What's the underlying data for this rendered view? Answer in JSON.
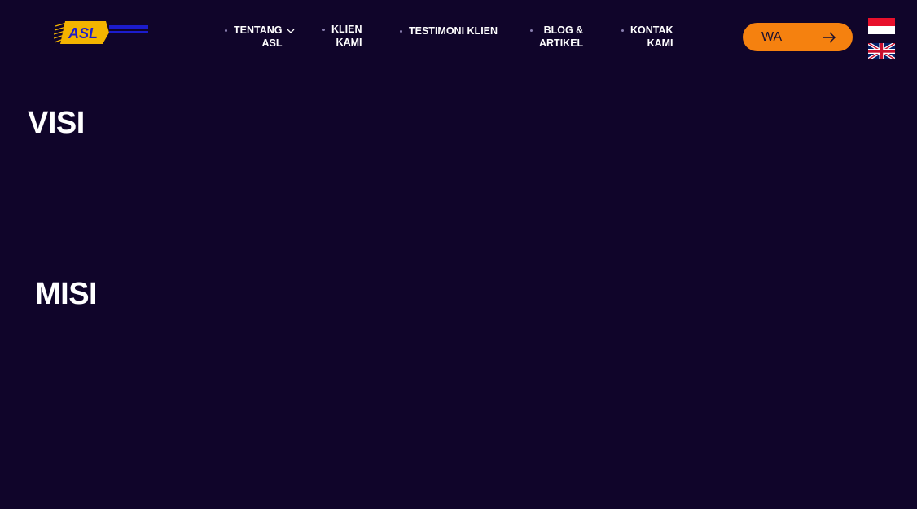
{
  "header": {
    "logo_text": "ASL",
    "nav": [
      {
        "label_line1": "TENTANG",
        "label_line2": "ASL",
        "has_dropdown": true
      },
      {
        "label_line1": "KLIEN",
        "label_line2": "KAMI"
      },
      {
        "label_line1": "TESTIMONI KLIEN",
        "label_line2": ""
      },
      {
        "label_line1": "BLOG &",
        "label_line2": "ARTIKEL"
      },
      {
        "label_line1": "KONTAK",
        "label_line2": "KAMI"
      }
    ],
    "wa_button": {
      "label": "WA",
      "icon": "arrow-right-icon"
    },
    "languages": [
      {
        "icon": "indonesia-flag-icon"
      },
      {
        "icon": "uk-flag-icon"
      }
    ]
  },
  "main": {
    "visi_heading": "VISI",
    "misi_heading": "MISI"
  },
  "colors": {
    "background": "#10052a",
    "accent": "#f5810f",
    "logo_blue": "#1c1ccc",
    "logo_yellow": "#f3b400"
  }
}
